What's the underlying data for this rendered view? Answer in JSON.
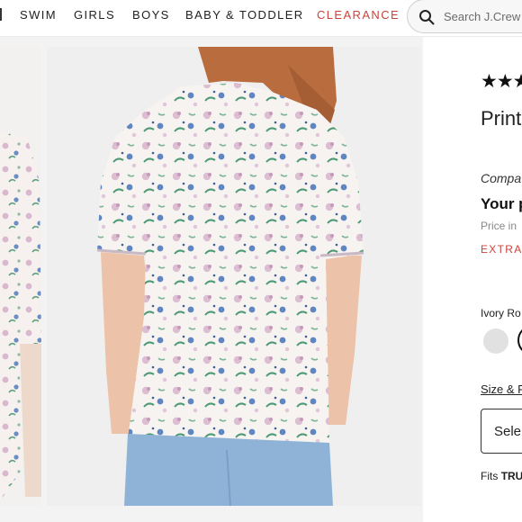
{
  "nav": {
    "items": [
      "SWIM",
      "GIRLS",
      "BOYS",
      "BABY & TODDLER"
    ],
    "clearance": "CLEARANCE"
  },
  "search": {
    "placeholder": "Search J.Crew",
    "icon": "search-icon"
  },
  "gallery": {
    "thumbnail_icon": "product-thumbnail",
    "main_image": "product-photo"
  },
  "product": {
    "rating_stars": "★★★",
    "title": "Print",
    "compare": "Compa",
    "your_price": "Your p",
    "price_note": "Price in",
    "extra": "EXTRA",
    "color_label": "Ivory Ro",
    "size_fit_link": "Size & F",
    "select_label": "Sele",
    "fits_prefix": "Fits",
    "fits_value": "TRU"
  },
  "colors": {
    "accent": "#c8453b",
    "nav_text": "#222222",
    "swatch": "#e1e1e1",
    "gallery_bg": "#efefef"
  }
}
